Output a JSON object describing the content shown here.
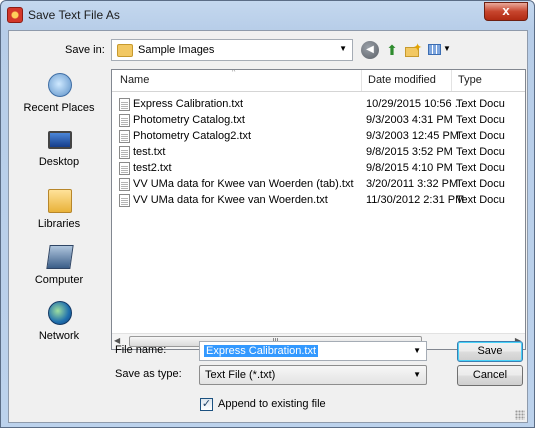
{
  "window": {
    "title": "Save Text File As",
    "close_label": "x"
  },
  "toolbar": {
    "save_in_label": "Save in:",
    "save_in_value": "Sample Images",
    "icons": [
      "back-icon",
      "up-folder-icon",
      "new-folder-icon",
      "views-menu-icon"
    ]
  },
  "places": [
    {
      "label": "Recent Places",
      "icon": "recent-places-icon"
    },
    {
      "label": "Desktop",
      "icon": "desktop-icon"
    },
    {
      "label": "Libraries",
      "icon": "libraries-icon"
    },
    {
      "label": "Computer",
      "icon": "computer-icon"
    },
    {
      "label": "Network",
      "icon": "network-icon"
    }
  ],
  "filelist": {
    "columns": [
      "Name",
      "Date modified",
      "Type"
    ],
    "files": [
      {
        "name": "Express Calibration.txt",
        "date": "10/29/2015 10:56 ...",
        "type": "Text Docu"
      },
      {
        "name": "Photometry Catalog.txt",
        "date": "9/3/2003 4:31 PM",
        "type": "Text Docu"
      },
      {
        "name": "Photometry Catalog2.txt",
        "date": "9/3/2003 12:45 PM",
        "type": "Text Docu"
      },
      {
        "name": "test.txt",
        "date": "9/8/2015 3:52 PM",
        "type": "Text Docu"
      },
      {
        "name": "test2.txt",
        "date": "9/8/2015 4:10 PM",
        "type": "Text Docu"
      },
      {
        "name": "VV UMa data for Kwee van Woerden (tab).txt",
        "date": "3/20/2011 3:32 PM",
        "type": "Text Docu"
      },
      {
        "name": "VV UMa data for Kwee van Woerden.txt",
        "date": "11/30/2012 2:31 PM",
        "type": "Text Docu"
      }
    ],
    "scroll_thumb_label": "III"
  },
  "form": {
    "file_name_label": "File name:",
    "file_name_value": "Express Calibration.txt",
    "save_as_type_label": "Save as type:",
    "save_as_type_value": "Text File (*.txt)",
    "save_button": "Save",
    "cancel_button": "Cancel",
    "append_label": "Append to existing file",
    "append_checked": true
  }
}
